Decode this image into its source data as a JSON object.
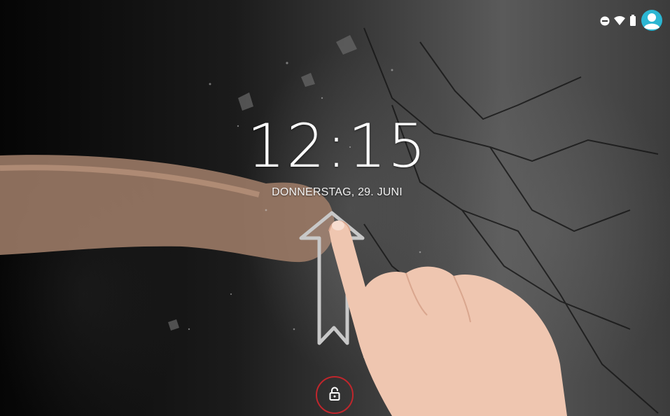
{
  "lockscreen": {
    "time": "12:15",
    "date": "DONNERSTAG, 29. JUNI"
  },
  "status_bar": {
    "icons": [
      "do-not-disturb-icon",
      "wifi-icon",
      "battery-icon",
      "user-avatar-icon"
    ],
    "avatar_color": "#2bb6d3"
  },
  "unlock": {
    "icon": "lock-open-icon",
    "highlight_color": "#c0262c"
  },
  "overlay": {
    "swipe_arrow_color": "#c8c8c8",
    "hint": "swipe-up-gesture"
  }
}
